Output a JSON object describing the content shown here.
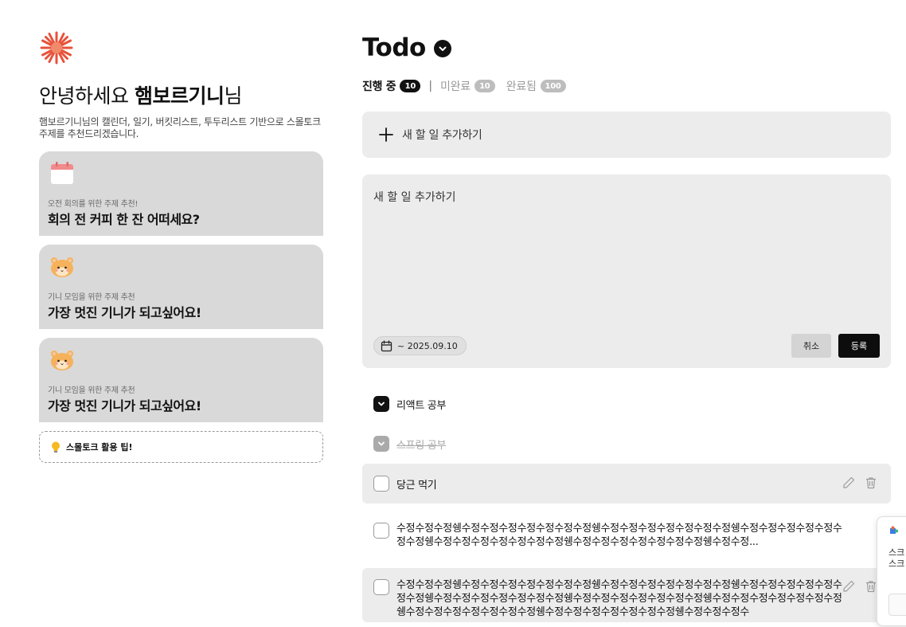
{
  "greeting": {
    "prefix": "안녕하세요 ",
    "name": "햄보르기니",
    "suffix": "님",
    "description": "햄보르기니님의 캘린더, 일기, 버킷리스트, 투두리스트 기반으로 스몰토크 주제를 추천드리겠습니다."
  },
  "cards": [
    {
      "icon": "calendar-icon",
      "caption": "오전 회의를 위한 주제 추천!",
      "title": "회의 전 커피 한 잔 어떠세요?"
    },
    {
      "icon": "hamster-icon",
      "caption": "기니 모임을 위한 주제 추천",
      "title": "가장 멋진 기니가 되고싶어요!"
    },
    {
      "icon": "hamster-icon",
      "caption": "기니 모임을 위한 주제 추천",
      "title": "가장 멋진 기니가 되고싶어요!"
    }
  ],
  "tip": {
    "label": "스몰토크 활용 팁!"
  },
  "todo": {
    "title": "Todo",
    "tabs": [
      {
        "label": "진행 중",
        "count": "10"
      },
      {
        "label": "미완료",
        "count": "10"
      },
      {
        "label": "완료됨",
        "count": "100"
      }
    ],
    "separator": "|",
    "add_label": "새 할 일 추가하기",
    "editor_placeholder": "새 할 일 추가하기",
    "due_date": "~ 2025.09.10",
    "cancel_label": "취소",
    "submit_label": "등록",
    "items": [
      {
        "text": "리액트 공부",
        "checked": true
      },
      {
        "text": "스프링 공부",
        "checked": true
      },
      {
        "text": "당근 먹기",
        "checked": false
      },
      {
        "text": "수정수정수정쉥수정수정수정수정수정수정수정쉥수정수정수정수정수정수정수정쉥수정수정수정수정수정수정수정쉥수정수정수정수정수정수정수정쉥수정수정수정수정수정수정수정쉥수정수정...",
        "checked": false
      },
      {
        "text": "수정수정수정쉥수정수정수정수정수정수정수정쉥수정수정수정수정수정수정수정쉥수정수정수정수정수정수정수정쉥수정수정수정수정수정수정수정쉥수정수정수정수정수정수정수정쉥수정수정수정수정수정수정수정쉥수정수정수정수정수정수정수정쉥수정수정수정수정수정수정수정쉥수정수정수정수",
        "checked": false
      }
    ]
  },
  "toast": {
    "line1": "스크",
    "line2": "스크"
  },
  "colors": {
    "card_bg": "#d9d9d9",
    "panel_bg": "#ececec",
    "accent": "#111111",
    "logo": "#e8523a"
  }
}
